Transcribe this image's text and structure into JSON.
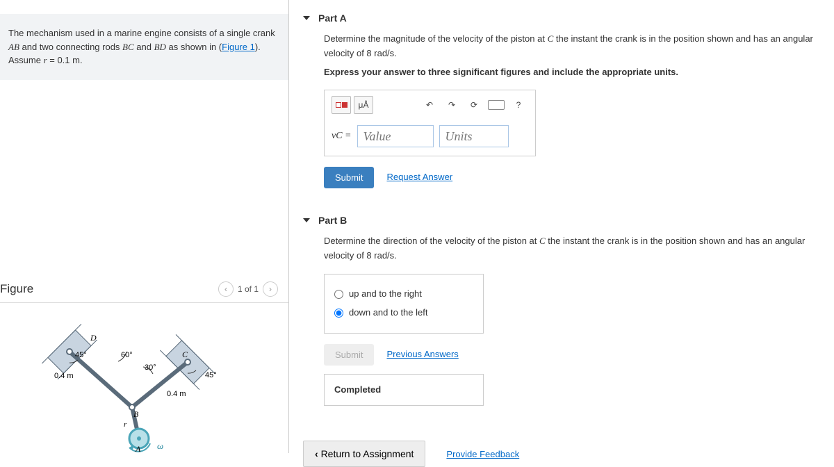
{
  "problem": {
    "text_before_fig": "The mechanism used in a marine engine consists of a single crank ",
    "ab": "AB",
    "text_mid1": " and two connecting rods ",
    "bc": "BC",
    "text_mid2": " and ",
    "bd": "BD",
    "text_mid3": " as shown in (",
    "figure_link": "Figure 1",
    "text_after_fig": "). Assume ",
    "r": "r",
    "eq": " = 0.1 ",
    "unit": "m",
    "period": "."
  },
  "figure": {
    "title": "Figure",
    "pager": "1 of 1"
  },
  "diagram": {
    "labels": {
      "D": "D",
      "C": "C",
      "B": "B",
      "A": "A",
      "omega": "ω"
    },
    "angles": {
      "a45_left": "45°",
      "a60": "60°",
      "a30": "30°",
      "a45_right": "45°"
    },
    "lengths": {
      "left": "0.4 m",
      "right": "0.4 m",
      "r": "r"
    }
  },
  "partA": {
    "title": "Part A",
    "instr1_before": "Determine the magnitude of the velocity of the piston at ",
    "instr1_C": "C",
    "instr1_mid": " the instant the crank is in the position shown and has an angular velocity of ",
    "instr1_val": "8 rad/s",
    "instr1_after": ".",
    "instr2": "Express your answer to three significant figures and include the appropriate units.",
    "label": "vC =",
    "value_ph": "Value",
    "units_ph": "Units",
    "submit": "Submit",
    "request": "Request Answer",
    "toolbar": {
      "units_sym": "μÅ",
      "help": "?"
    }
  },
  "partB": {
    "title": "Part B",
    "instr_before": "Determine the direction of the velocity of the piston at ",
    "instr_C": "C",
    "instr_mid": " the instant the crank is in the position shown and has an angular velocity of ",
    "instr_val": "8 rad/s",
    "instr_after": ".",
    "opt1": "up and to the right",
    "opt2": "down and to the left",
    "submit": "Submit",
    "previous": "Previous Answers",
    "completed": "Completed"
  },
  "footer": {
    "return": "Return to Assignment",
    "feedback": "Provide Feedback"
  }
}
